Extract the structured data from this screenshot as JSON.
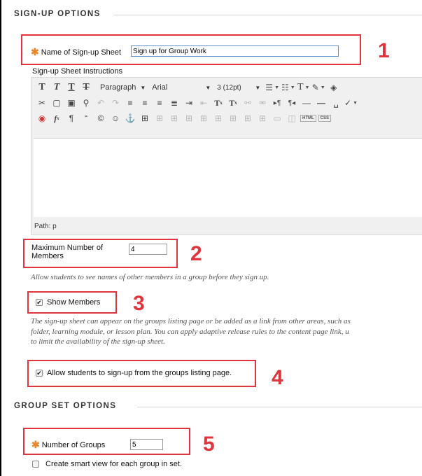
{
  "signup_options": {
    "heading": "SIGN-UP OPTIONS",
    "name_field": {
      "required_marker": "✱",
      "label": "Name of Sign-up Sheet",
      "value": "Sign up for Group Work",
      "callout": "1"
    },
    "instructions": {
      "label": "Sign-up Sheet Instructions",
      "toolbar": {
        "row1": [
          "bold-t",
          "italic-t",
          "underline-t",
          "strikethrough-t"
        ],
        "format_select": "Paragraph",
        "font_select": "Arial",
        "size_select": "3 (12pt)"
      },
      "path_label": "Path:",
      "path_value": "p"
    },
    "max_members": {
      "label_line1": "Maximum Number of",
      "label_line2": "Members",
      "value": "4",
      "callout": "2",
      "help": "Allow students to see names of other members in a group before they sign up."
    },
    "show_members": {
      "checked": true,
      "label": "Show Members",
      "callout": "3",
      "help": [
        "The sign-up sheet can appear on the groups listing page or be added as a link from other areas, such as",
        "folder, learning module, or lesson plan. You can apply adaptive release rules to the content page link, u",
        "to limit the availability of the sign-up sheet."
      ]
    },
    "allow_signup": {
      "checked": true,
      "label": "Allow students to sign-up from the groups listing page.",
      "callout": "4"
    }
  },
  "group_set_options": {
    "heading": "GROUP SET OPTIONS",
    "number_of_groups": {
      "required_marker": "✱",
      "label": "Number of Groups",
      "value": "5",
      "callout": "5"
    },
    "smart_view": {
      "checked": false,
      "label": "Create smart view for each group in set."
    }
  },
  "colors": {
    "highlight": "#e0353d",
    "required": "#e8882e"
  }
}
